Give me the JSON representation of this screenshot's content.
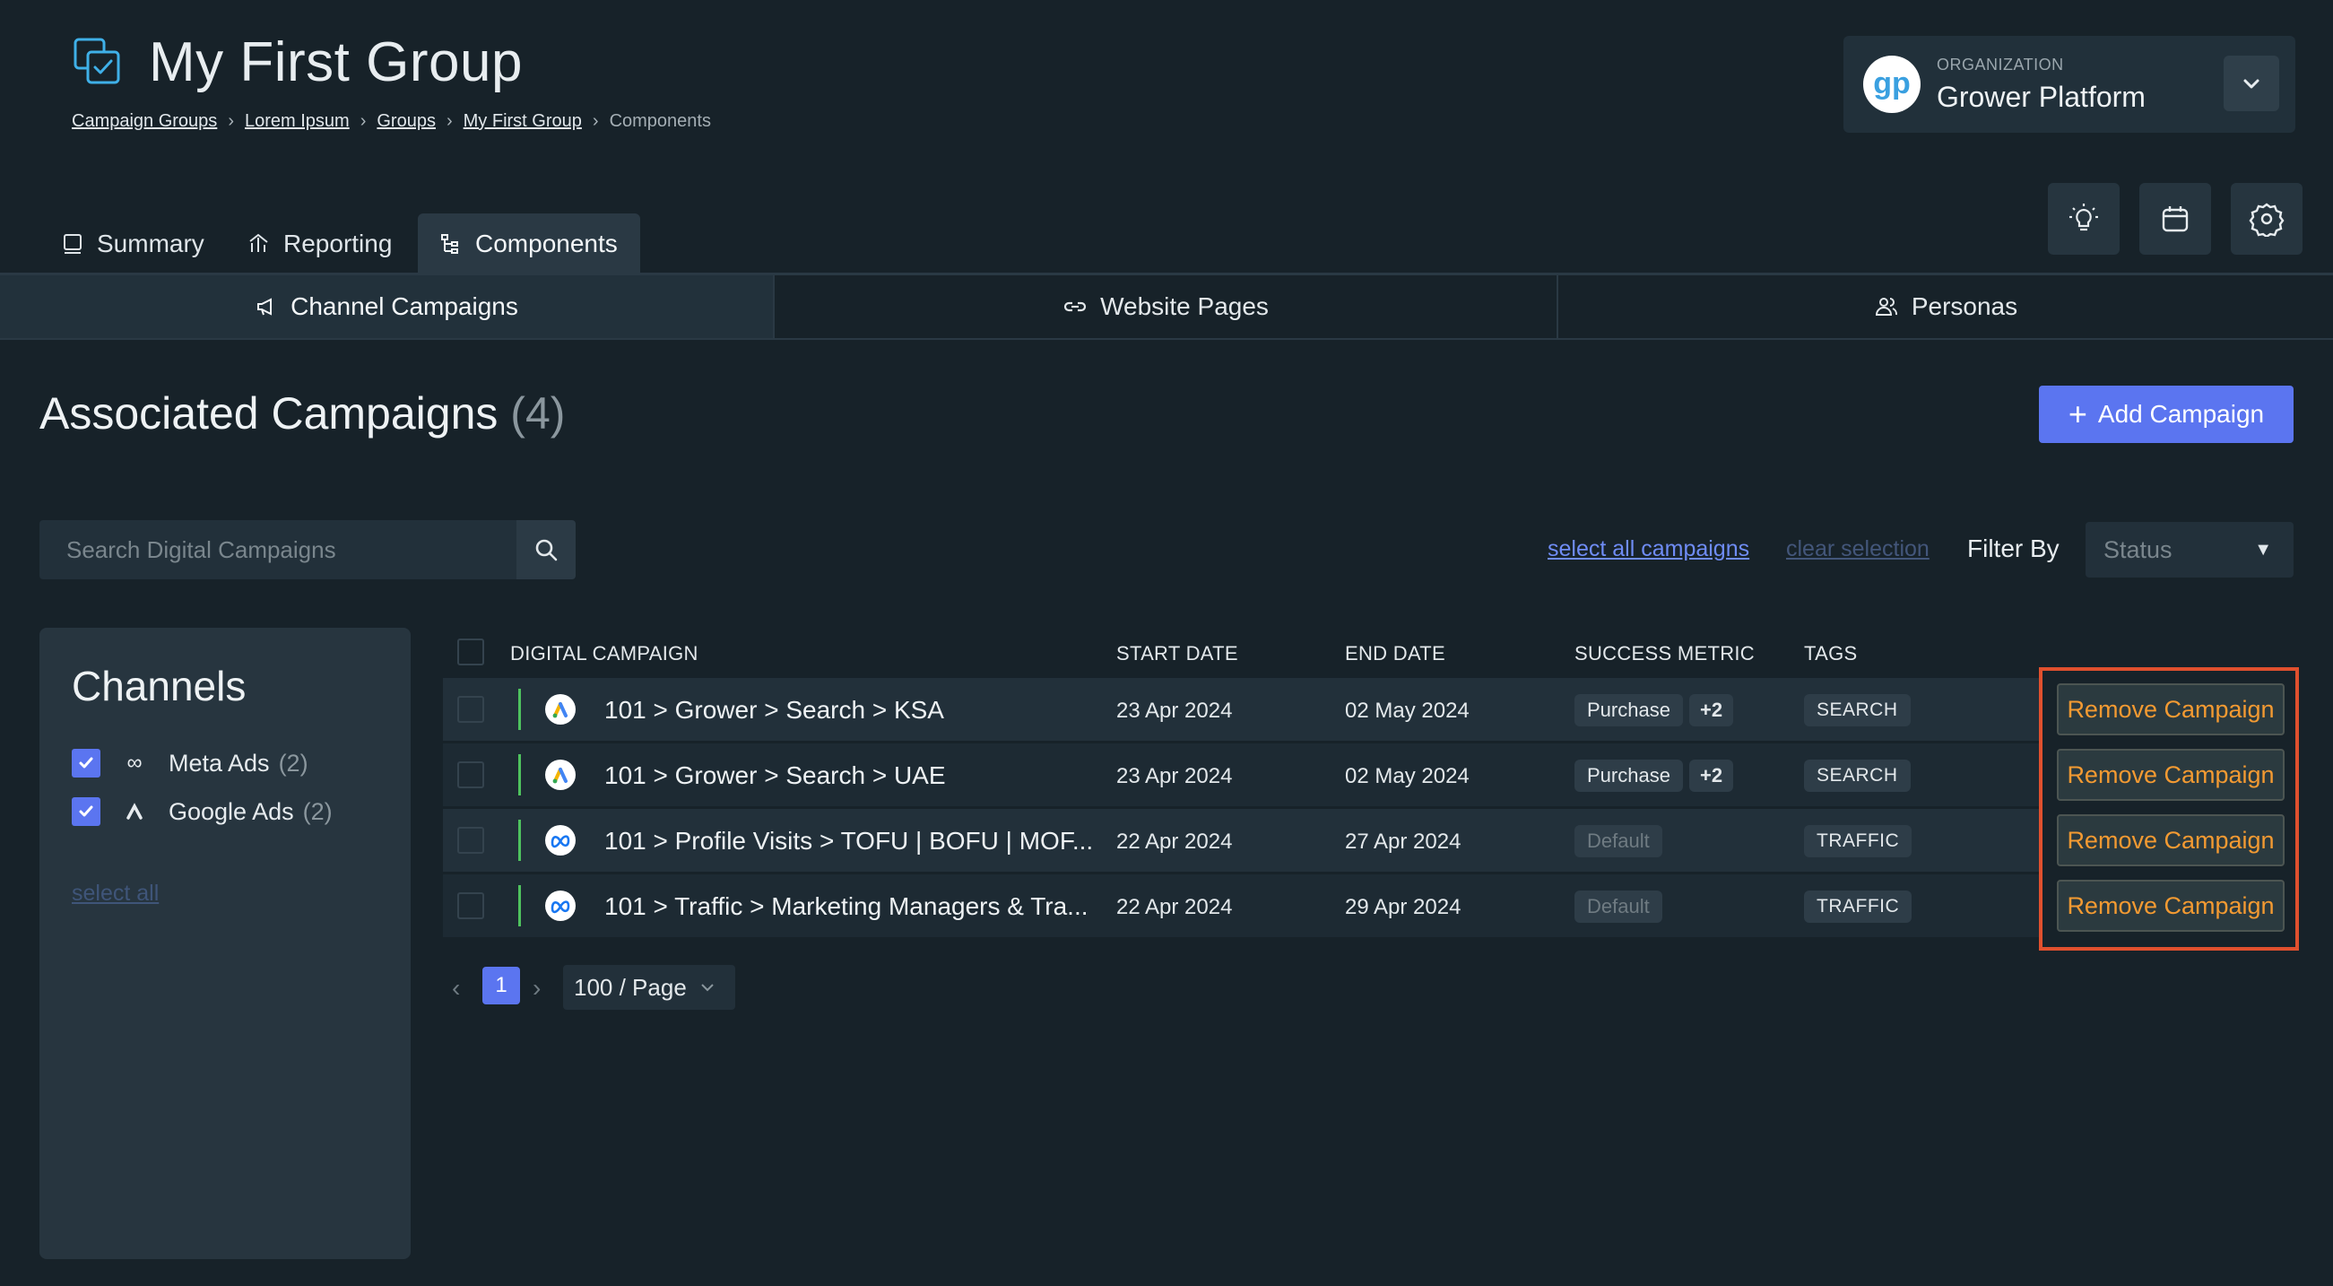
{
  "header": {
    "title": "My First Group",
    "breadcrumb": [
      "Campaign Groups",
      "Lorem Ipsum",
      "Groups",
      "My First Group"
    ],
    "breadcrumb_current": "Components"
  },
  "organization": {
    "label": "ORGANIZATION",
    "name": "Grower Platform",
    "logo_text": "gp"
  },
  "toolbar": {
    "icons": [
      "lightbulb-icon",
      "calendar-icon",
      "settings-icon"
    ]
  },
  "tabs": [
    {
      "label": "Summary",
      "icon": "book-icon",
      "active": false
    },
    {
      "label": "Reporting",
      "icon": "chart-icon",
      "active": false
    },
    {
      "label": "Components",
      "icon": "tree-icon",
      "active": true
    }
  ],
  "subtabs": [
    {
      "label": "Channel Campaigns",
      "icon": "megaphone-icon",
      "active": true
    },
    {
      "label": "Website Pages",
      "icon": "link-icon",
      "active": false
    },
    {
      "label": "Personas",
      "icon": "users-icon",
      "active": false
    }
  ],
  "section": {
    "title": "Associated Campaigns",
    "count": "(4)",
    "add_button": "Add Campaign"
  },
  "search": {
    "placeholder": "Search Digital Campaigns"
  },
  "filters": {
    "select_all_campaigns": "select all campaigns",
    "clear_selection": "clear selection",
    "filter_by": "Filter By",
    "status_placeholder": "Status"
  },
  "channels": {
    "title": "Channels",
    "items": [
      {
        "label": "Meta Ads",
        "count": "(2)",
        "checked": true
      },
      {
        "label": "Google Ads",
        "count": "(2)",
        "checked": true
      }
    ],
    "select_all": "select all"
  },
  "table": {
    "headers": [
      "DIGITAL CAMPAIGN",
      "START DATE",
      "END DATE",
      "SUCCESS METRIC",
      "TAGS"
    ],
    "rows": [
      {
        "platform": "google",
        "name": "101 > Grower > Search > KSA",
        "start": "23 Apr 2024",
        "end": "02 May 2024",
        "metric": "Purchase",
        "metric_extra": "+2",
        "tag": "SEARCH"
      },
      {
        "platform": "google",
        "name": "101 > Grower > Search > UAE",
        "start": "23 Apr 2024",
        "end": "02 May 2024",
        "metric": "Purchase",
        "metric_extra": "+2",
        "tag": "SEARCH"
      },
      {
        "platform": "meta",
        "name": "101 > Profile Visits > TOFU | BOFU | MOF...",
        "start": "22 Apr 2024",
        "end": "27 Apr 2024",
        "metric": "Default",
        "metric_extra": "",
        "tag": "TRAFFIC"
      },
      {
        "platform": "meta",
        "name": "101 > Traffic > Marketing Managers & Tra...",
        "start": "22 Apr 2024",
        "end": "29 Apr 2024",
        "metric": "Default",
        "metric_extra": "",
        "tag": "TRAFFIC"
      }
    ],
    "remove_label": "Remove Campaign"
  },
  "pagination": {
    "current": "1",
    "page_size": "100 / Page"
  },
  "colors": {
    "background": "#172229",
    "accent": "#5b75f0",
    "remove_text": "#f39a32",
    "highlight_border": "#e0502e",
    "row_bar": "#4ec25e"
  }
}
